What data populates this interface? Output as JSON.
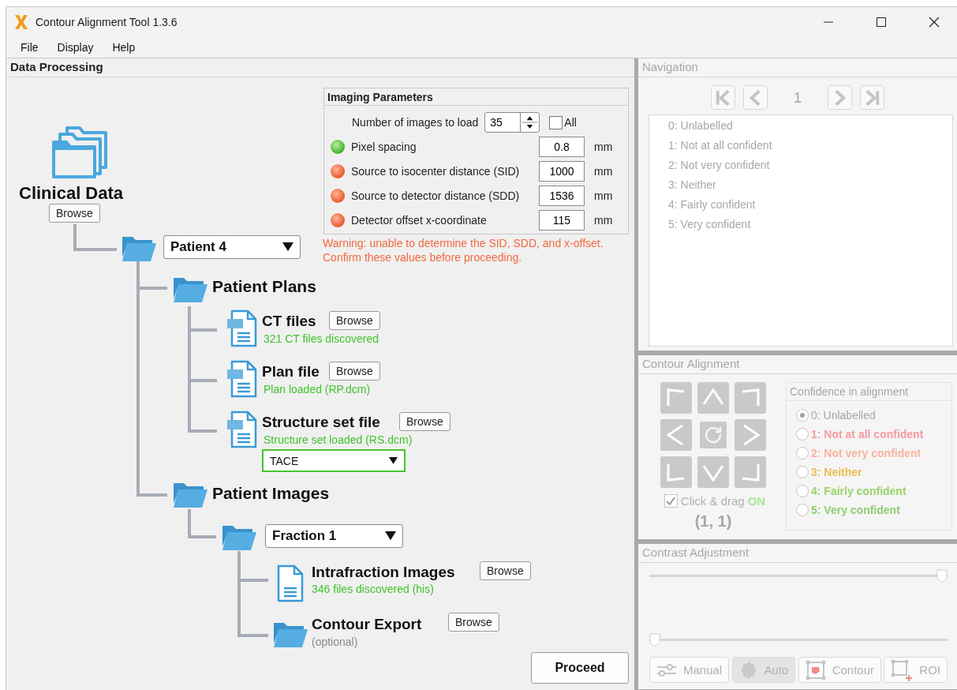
{
  "window": {
    "title": "Contour Alignment Tool 1.3.6"
  },
  "menu": [
    "File",
    "Display",
    "Help"
  ],
  "data_processing": {
    "title": "Data Processing",
    "clinical_data": {
      "label": "Clinical Data",
      "button": "Browse"
    },
    "patient": {
      "value": "Patient 4"
    },
    "plans": {
      "label": "Patient Plans"
    },
    "plan_files": [
      {
        "label": "CT files",
        "button": "Browse",
        "status": "321 CT files discovered"
      },
      {
        "label": "Plan file",
        "button": "Browse",
        "status": "Plan loaded (RP.dcm)"
      },
      {
        "label": "Structure set file",
        "button": "Browse",
        "status": "Structure set loaded (RS.dcm)",
        "dropdown": {
          "value": "TACE",
          "highlighted": true
        }
      }
    ],
    "images": {
      "label": "Patient Images"
    },
    "fraction": {
      "value": "Fraction 1"
    },
    "image_items": [
      {
        "kind": "document",
        "label": "Intrafraction Images",
        "button": "Browse",
        "status": "346 files discovered (his)"
      },
      {
        "kind": "folder",
        "label": "Contour Export",
        "button": "Browse",
        "note": "(optional)"
      }
    ],
    "imaging_parameters": {
      "title": "Imaging Parameters",
      "count_label": "Number of images to load",
      "count": "35",
      "all_label": "All",
      "all_checked": false,
      "params": [
        {
          "label": "Pixel spacing",
          "value": "0.8",
          "unit": "mm",
          "ok": true
        },
        {
          "label": "Source to isocenter distance (SID)",
          "value": "1000",
          "unit": "mm",
          "ok": false
        },
        {
          "label": "Source to detector distance (SDD)",
          "value": "1536",
          "unit": "mm",
          "ok": false
        },
        {
          "label": "Detector offset x-coordinate",
          "value": "115",
          "unit": "mm",
          "ok": false
        }
      ]
    },
    "warning": "Warning: unable to determine the SID, SDD, and x-offset. Confirm these values before proceeding.",
    "proceed": "Proceed"
  },
  "navigation": {
    "title": "Navigation",
    "disabled": true,
    "page": "1",
    "items": [
      "0: Unlabelled",
      "1: Not at all confident",
      "2: Not very confident",
      "3: Neither",
      "4: Fairly confident",
      "5: Very confident"
    ]
  },
  "contour_alignment": {
    "title": "Contour Alignment",
    "disabled": true,
    "click_drag": {
      "label": "Click & drag",
      "checked": true,
      "state": "ON"
    },
    "position": "(1, 1)",
    "confidence": {
      "title": "Confidence in alignment",
      "options": [
        {
          "label": "0: Unlabelled",
          "color": "#a6a6a6",
          "selected": true
        },
        {
          "label": "1: Not at all confident",
          "color": "#f79aa0",
          "selected": false
        },
        {
          "label": "2: Not very confident",
          "color": "#f8b49c",
          "selected": false
        },
        {
          "label": "3: Neither",
          "color": "#e8bf4e",
          "selected": false
        },
        {
          "label": "4: Fairly confident",
          "color": "#98d46c",
          "selected": false
        },
        {
          "label": "5: Very confident",
          "color": "#8ccf72",
          "selected": false
        }
      ]
    }
  },
  "contrast_adjustment": {
    "title": "Contrast Adjustment",
    "disabled": true,
    "sliders": [
      {
        "level": 1
      },
      {
        "level": 0
      }
    ],
    "buttons": [
      {
        "kind": "manual",
        "label": "Manual",
        "selected": false
      },
      {
        "kind": "auto",
        "label": "Auto",
        "selected": true
      },
      {
        "kind": "contour",
        "label": "Contour",
        "selected": false
      },
      {
        "kind": "roi",
        "label": "ROI",
        "selected": false
      }
    ]
  }
}
